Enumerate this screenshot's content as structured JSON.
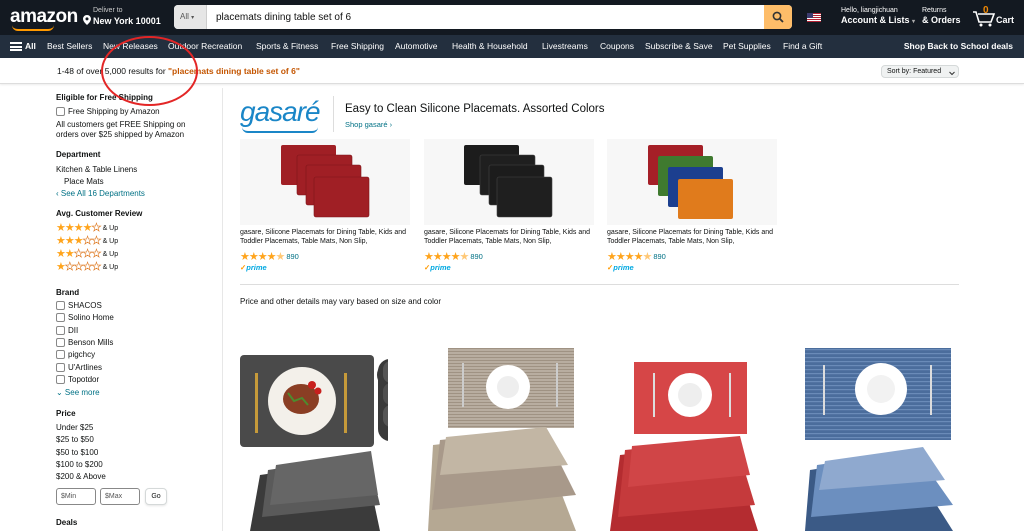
{
  "header": {
    "logo": "amazon",
    "deliver_line1": "Deliver to",
    "deliver_line2": "New York 10001",
    "search_category": "All",
    "search_value": "placemats dining table set of 6",
    "account_line1": "Hello, liangjichuan",
    "account_line2": "Account & Lists",
    "returns_line1": "Returns",
    "returns_line2": "& Orders",
    "cart_count": "0",
    "cart_label": "Cart"
  },
  "subnav": {
    "all": "All",
    "items": [
      "Best Sellers",
      "New Releases",
      "Outdoor Recreation",
      "Sports & Fitness",
      "Free Shipping",
      "Automotive",
      "Health & Household",
      "Livestreams",
      "Coupons",
      "Subscribe & Save",
      "Pet Supplies",
      "Find a Gift"
    ],
    "promo": "Shop Back to School deals"
  },
  "results": {
    "count_text": "1-48 of over 5,000 results for ",
    "query": "\"placemats dining table set of 6\"",
    "sort_label": "Sort by:",
    "sort_value": "Featured"
  },
  "sidebar": {
    "free_shipping_heading": "Eligible for Free Shipping",
    "free_shipping_option": "Free Shipping by Amazon",
    "free_shipping_note_1": "All customers get FREE Shipping on",
    "free_shipping_note_2": "orders over $25 shipped by Amazon",
    "department_heading": "Department",
    "department_items": [
      "Kitchen & Table Linens",
      "Place Mats"
    ],
    "department_see_all": "‹ See All 16 Departments",
    "review_heading": "Avg. Customer Review",
    "review_rows": [
      4,
      3,
      2,
      1
    ],
    "review_suffix": "& Up",
    "brand_heading": "Brand",
    "brands": [
      "SHACOS",
      "Solino Home",
      "DII",
      "Benson Mills",
      "pigchcy",
      "U'Artlines",
      "Topotdor"
    ],
    "brand_see_more": "⌄ See more",
    "price_heading": "Price",
    "prices": [
      "Under $25",
      "$25 to $50",
      "$50 to $100",
      "$100 to $200",
      "$200 & Above"
    ],
    "min_placeholder": "$Min",
    "max_placeholder": "$Max",
    "go_label": "Go",
    "deals_heading": "Deals"
  },
  "sponsored": {
    "brand_logo": "gasaré",
    "headline": "Easy to Clean Silicone Placemats. Assorted Colors",
    "shop_link": "Shop gasaré ›",
    "cards": [
      {
        "title": "gasare, Silicone Placemats for Dining Table, Kids and Toddler Placemats, Table Mats, Non Slip,",
        "rating": 4.5,
        "count": "890",
        "prime": "prime",
        "colors": [
          "#9b1c22"
        ]
      },
      {
        "title": "gasare, Silicone Placemats for Dining Table, Kids and Toddler Placemats, Table Mats, Non Slip,",
        "rating": 4.5,
        "count": "890",
        "prime": "prime",
        "colors": [
          "#1c1c1c"
        ]
      },
      {
        "title": "gasare, Silicone Placemats for Dining Table, Kids and Toddler Placemats, Table Mats, Non Slip,",
        "rating": 4.5,
        "count": "890",
        "prime": "prime",
        "colors": [
          "#a51f27",
          "#3f7a2f",
          "#1c3f8f",
          "#e07b1c"
        ]
      }
    ]
  },
  "price_note": "Price and other details may vary based on size and color",
  "colors": {
    "nav_dark": "#131921",
    "nav_sub": "#232f3e",
    "search_button": "#febd69",
    "link": "#007185",
    "query_orange": "#c45500",
    "star": "#ffa41c",
    "annotation": "#e32626"
  }
}
